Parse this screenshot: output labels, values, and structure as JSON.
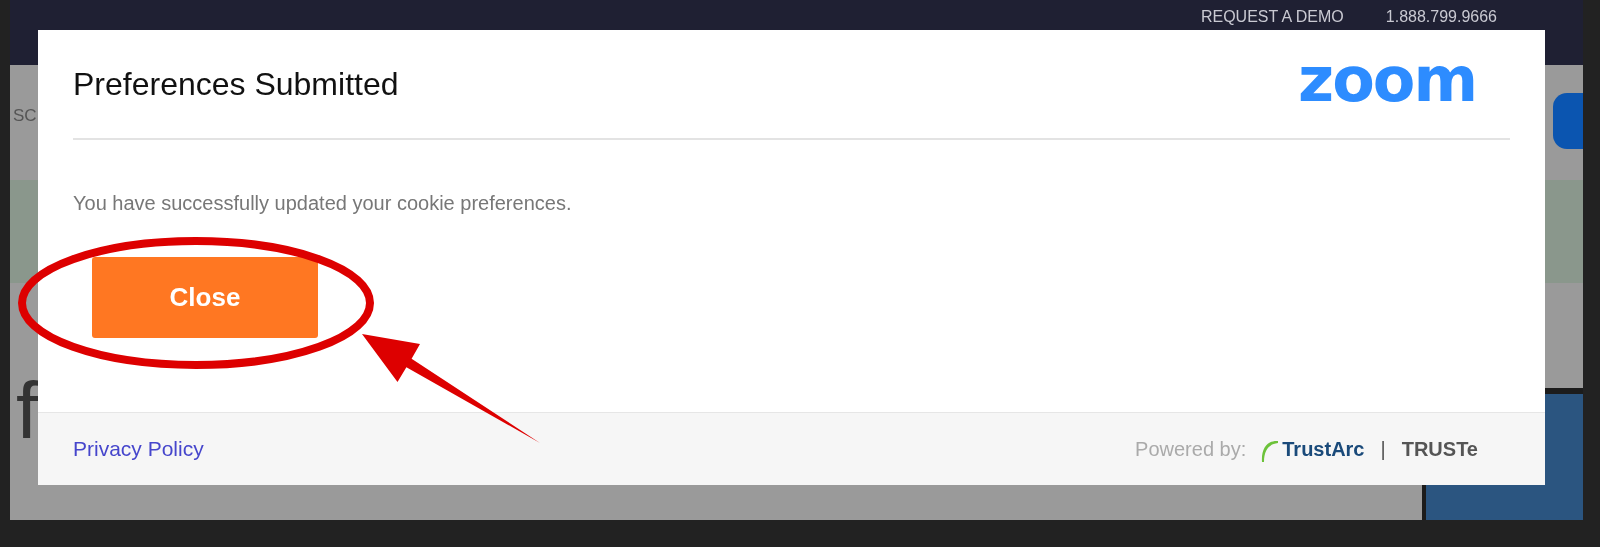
{
  "background_page": {
    "nav_links": [
      "REQUEST A DEMO",
      "1.888.799.9666"
    ],
    "section_label": "SC",
    "heading_fragment": "f"
  },
  "dialog": {
    "title": "Preferences Submitted",
    "logo": "zoom",
    "message": "You have successfully updated your cookie preferences.",
    "button": "Close",
    "footer": {
      "link": "Privacy Policy",
      "powered_by": "Powered by:",
      "brand": "TrustArc",
      "separator": "|",
      "brand_2": "TRUSTe"
    }
  }
}
